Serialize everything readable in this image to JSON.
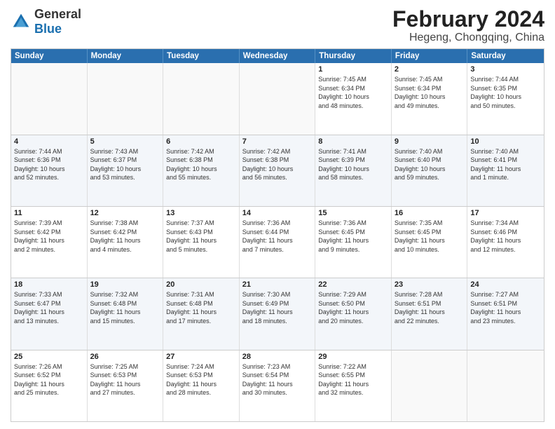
{
  "header": {
    "logo": {
      "general": "General",
      "blue": "Blue"
    },
    "title": "February 2024",
    "subtitle": "Hegeng, Chongqing, China"
  },
  "calendar": {
    "weekdays": [
      "Sunday",
      "Monday",
      "Tuesday",
      "Wednesday",
      "Thursday",
      "Friday",
      "Saturday"
    ],
    "weeks": [
      [
        {
          "day": "",
          "info": ""
        },
        {
          "day": "",
          "info": ""
        },
        {
          "day": "",
          "info": ""
        },
        {
          "day": "",
          "info": ""
        },
        {
          "day": "1",
          "info": "Sunrise: 7:45 AM\nSunset: 6:34 PM\nDaylight: 10 hours\nand 48 minutes."
        },
        {
          "day": "2",
          "info": "Sunrise: 7:45 AM\nSunset: 6:34 PM\nDaylight: 10 hours\nand 49 minutes."
        },
        {
          "day": "3",
          "info": "Sunrise: 7:44 AM\nSunset: 6:35 PM\nDaylight: 10 hours\nand 50 minutes."
        }
      ],
      [
        {
          "day": "4",
          "info": "Sunrise: 7:44 AM\nSunset: 6:36 PM\nDaylight: 10 hours\nand 52 minutes."
        },
        {
          "day": "5",
          "info": "Sunrise: 7:43 AM\nSunset: 6:37 PM\nDaylight: 10 hours\nand 53 minutes."
        },
        {
          "day": "6",
          "info": "Sunrise: 7:42 AM\nSunset: 6:38 PM\nDaylight: 10 hours\nand 55 minutes."
        },
        {
          "day": "7",
          "info": "Sunrise: 7:42 AM\nSunset: 6:38 PM\nDaylight: 10 hours\nand 56 minutes."
        },
        {
          "day": "8",
          "info": "Sunrise: 7:41 AM\nSunset: 6:39 PM\nDaylight: 10 hours\nand 58 minutes."
        },
        {
          "day": "9",
          "info": "Sunrise: 7:40 AM\nSunset: 6:40 PM\nDaylight: 10 hours\nand 59 minutes."
        },
        {
          "day": "10",
          "info": "Sunrise: 7:40 AM\nSunset: 6:41 PM\nDaylight: 11 hours\nand 1 minute."
        }
      ],
      [
        {
          "day": "11",
          "info": "Sunrise: 7:39 AM\nSunset: 6:42 PM\nDaylight: 11 hours\nand 2 minutes."
        },
        {
          "day": "12",
          "info": "Sunrise: 7:38 AM\nSunset: 6:42 PM\nDaylight: 11 hours\nand 4 minutes."
        },
        {
          "day": "13",
          "info": "Sunrise: 7:37 AM\nSunset: 6:43 PM\nDaylight: 11 hours\nand 5 minutes."
        },
        {
          "day": "14",
          "info": "Sunrise: 7:36 AM\nSunset: 6:44 PM\nDaylight: 11 hours\nand 7 minutes."
        },
        {
          "day": "15",
          "info": "Sunrise: 7:36 AM\nSunset: 6:45 PM\nDaylight: 11 hours\nand 9 minutes."
        },
        {
          "day": "16",
          "info": "Sunrise: 7:35 AM\nSunset: 6:45 PM\nDaylight: 11 hours\nand 10 minutes."
        },
        {
          "day": "17",
          "info": "Sunrise: 7:34 AM\nSunset: 6:46 PM\nDaylight: 11 hours\nand 12 minutes."
        }
      ],
      [
        {
          "day": "18",
          "info": "Sunrise: 7:33 AM\nSunset: 6:47 PM\nDaylight: 11 hours\nand 13 minutes."
        },
        {
          "day": "19",
          "info": "Sunrise: 7:32 AM\nSunset: 6:48 PM\nDaylight: 11 hours\nand 15 minutes."
        },
        {
          "day": "20",
          "info": "Sunrise: 7:31 AM\nSunset: 6:48 PM\nDaylight: 11 hours\nand 17 minutes."
        },
        {
          "day": "21",
          "info": "Sunrise: 7:30 AM\nSunset: 6:49 PM\nDaylight: 11 hours\nand 18 minutes."
        },
        {
          "day": "22",
          "info": "Sunrise: 7:29 AM\nSunset: 6:50 PM\nDaylight: 11 hours\nand 20 minutes."
        },
        {
          "day": "23",
          "info": "Sunrise: 7:28 AM\nSunset: 6:51 PM\nDaylight: 11 hours\nand 22 minutes."
        },
        {
          "day": "24",
          "info": "Sunrise: 7:27 AM\nSunset: 6:51 PM\nDaylight: 11 hours\nand 23 minutes."
        }
      ],
      [
        {
          "day": "25",
          "info": "Sunrise: 7:26 AM\nSunset: 6:52 PM\nDaylight: 11 hours\nand 25 minutes."
        },
        {
          "day": "26",
          "info": "Sunrise: 7:25 AM\nSunset: 6:53 PM\nDaylight: 11 hours\nand 27 minutes."
        },
        {
          "day": "27",
          "info": "Sunrise: 7:24 AM\nSunset: 6:53 PM\nDaylight: 11 hours\nand 28 minutes."
        },
        {
          "day": "28",
          "info": "Sunrise: 7:23 AM\nSunset: 6:54 PM\nDaylight: 11 hours\nand 30 minutes."
        },
        {
          "day": "29",
          "info": "Sunrise: 7:22 AM\nSunset: 6:55 PM\nDaylight: 11 hours\nand 32 minutes."
        },
        {
          "day": "",
          "info": ""
        },
        {
          "day": "",
          "info": ""
        }
      ]
    ]
  }
}
